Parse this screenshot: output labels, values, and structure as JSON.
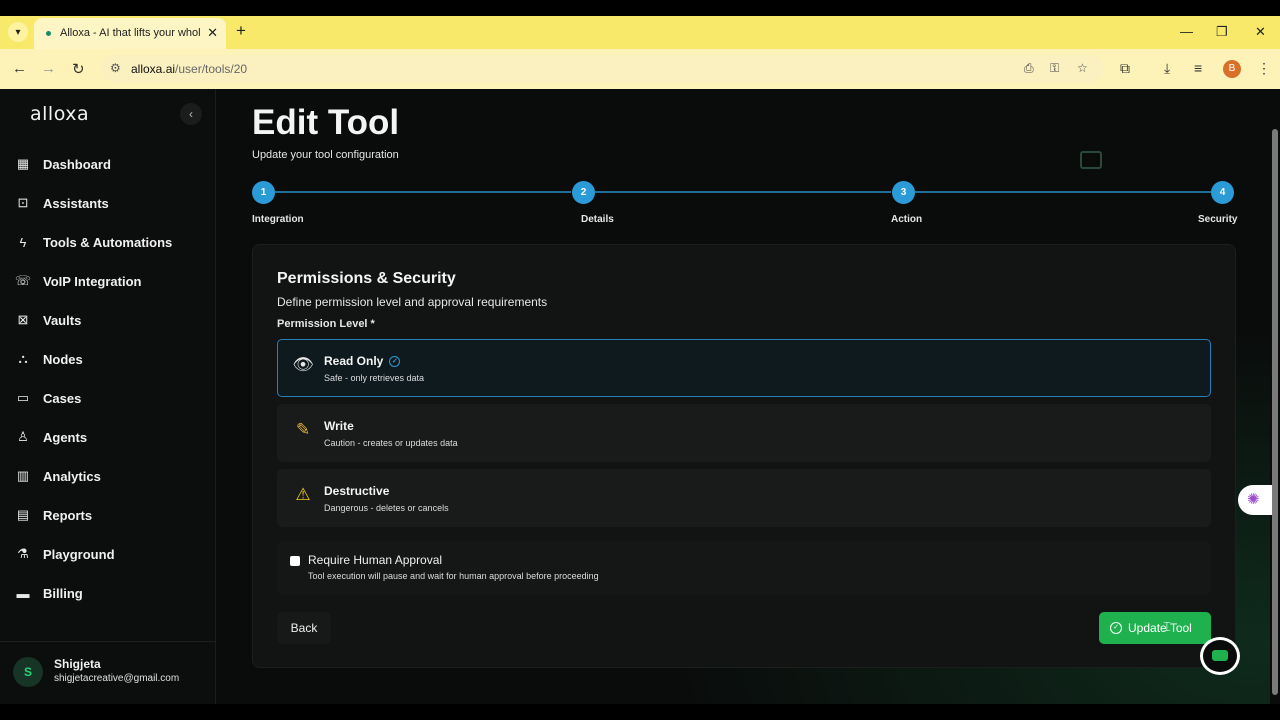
{
  "browser": {
    "tab_title": "Alloxa - AI that lifts your whole",
    "url_host": "alloxa.ai",
    "url_path": "/user/tools/20",
    "profile_initial": "B"
  },
  "sidebar": {
    "logo": "alloxa",
    "items": [
      {
        "label": "Dashboard",
        "icon": "grid-icon"
      },
      {
        "label": "Assistants",
        "icon": "robot-icon"
      },
      {
        "label": "Tools & Automations",
        "icon": "bolt-icon"
      },
      {
        "label": "VoIP Integration",
        "icon": "phone-icon"
      },
      {
        "label": "Vaults",
        "icon": "vault-icon"
      },
      {
        "label": "Nodes",
        "icon": "network-icon"
      },
      {
        "label": "Cases",
        "icon": "folder-icon"
      },
      {
        "label": "Agents",
        "icon": "users-icon"
      },
      {
        "label": "Analytics",
        "icon": "chart-icon"
      },
      {
        "label": "Reports",
        "icon": "document-icon"
      },
      {
        "label": "Playground",
        "icon": "flask-icon"
      },
      {
        "label": "Billing",
        "icon": "card-icon"
      }
    ],
    "user": {
      "initial": "S",
      "name": "Shigjeta",
      "email": "shigjetacreative@gmail.com"
    }
  },
  "page": {
    "title": "Edit Tool",
    "subtitle": "Update your tool configuration"
  },
  "stepper": {
    "steps": [
      {
        "number": "1",
        "label": "Integration"
      },
      {
        "number": "2",
        "label": "Details"
      },
      {
        "number": "3",
        "label": "Action"
      },
      {
        "number": "4",
        "label": "Security"
      }
    ],
    "current": 4
  },
  "permissions": {
    "title": "Permissions & Security",
    "subtitle": "Define permission level and approval requirements",
    "level_label": "Permission Level *",
    "options": [
      {
        "title": "Read Only",
        "desc": "Safe - only retrieves data",
        "icon": "eye-icon",
        "selected": true
      },
      {
        "title": "Write",
        "desc": "Caution - creates or updates data",
        "icon": "pencil-icon",
        "selected": false
      },
      {
        "title": "Destructive",
        "desc": "Dangerous - deletes or cancels",
        "icon": "warning-icon",
        "selected": false
      }
    ],
    "approval": {
      "title": "Require Human Approval",
      "desc": "Tool execution will pause and wait for human approval before proceeding",
      "checked": false
    }
  },
  "actions": {
    "back_label": "Back",
    "update_label": "Update Tool"
  },
  "colors": {
    "accent_blue": "#2a9bd6",
    "accent_green": "#20b14f",
    "background": "#0a0c0b",
    "browser_yellow": "#f8e96a"
  }
}
